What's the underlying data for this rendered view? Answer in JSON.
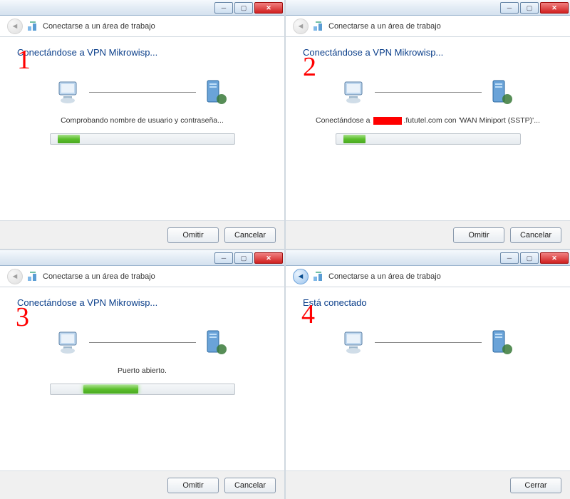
{
  "common": {
    "window_title": "Conectarse a un área de trabajo",
    "main_title_connecting": "Conectándose a VPN Mikrowisp...",
    "main_title_connected": "Está conectado",
    "btn_skip": "Omitir",
    "btn_cancel": "Cancelar",
    "btn_close": "Cerrar"
  },
  "panels": {
    "p1": {
      "annotation": "1",
      "status": "Comprobando nombre de usuario y contraseña...",
      "progress": {
        "left_pct": 4,
        "width_pct": 12
      }
    },
    "p2": {
      "annotation": "2",
      "status_prefix": "Conectándose a ",
      "status_suffix": ".fututel.com con 'WAN Miniport (SSTP)'...",
      "progress": {
        "left_pct": 4,
        "width_pct": 12
      }
    },
    "p3": {
      "annotation": "3",
      "status": "Puerto abierto.",
      "progress": {
        "left_pct": 18,
        "width_pct": 30
      }
    },
    "p4": {
      "annotation": "4"
    }
  }
}
